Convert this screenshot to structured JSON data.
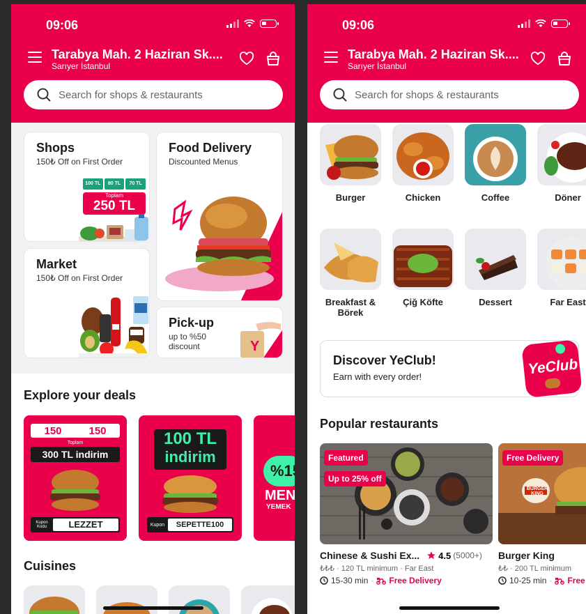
{
  "status": {
    "time": "09:06"
  },
  "header": {
    "address_title": "Tarabya Mah. 2 Haziran Sk....",
    "address_sub": "Sarıyer İstanbul",
    "icons": [
      "menu-icon",
      "heart-icon",
      "bag-icon"
    ]
  },
  "search": {
    "placeholder": "Search for shops & restaurants"
  },
  "services": {
    "shops": {
      "title": "Shops",
      "subtitle": "150₺ Off on First Order",
      "promo": {
        "tier1": "100 TL",
        "tier2": "80 TL",
        "tier3": "70 TL",
        "total_label": "Toplam",
        "total": "250 TL"
      }
    },
    "market": {
      "title": "Market",
      "subtitle": "150₺ Off on First Order"
    },
    "food": {
      "title": "Food Delivery",
      "subtitle": "Discounted Menus"
    },
    "pickup": {
      "title": "Pick-up",
      "subtitle_line1": "up to %50",
      "subtitle_line2": "discount"
    }
  },
  "deals": {
    "title": "Explore your deals",
    "items": [
      {
        "top_a": "150",
        "top_b": "150",
        "tl": "TL",
        "total_label": "Toplam",
        "headline": "300 TL indirim",
        "coupon_label": "Kupon Kodu",
        "code": "LEZZET"
      },
      {
        "headline_1": "100 TL",
        "headline_2": "indirim",
        "coupon_label": "Kupon",
        "code": "SEPETTE100"
      },
      {
        "headline_1": "%15",
        "headline_2": "MEN",
        "headline_3": "YEMEK"
      }
    ]
  },
  "cuisines_title": "Cuisines",
  "cuisines": [
    {
      "label": "Burger"
    },
    {
      "label": "Chicken"
    },
    {
      "label": "Coffee"
    },
    {
      "label": "Döner"
    },
    {
      "label": "Breakfast &\nBörek"
    },
    {
      "label": "Çiğ Köfte"
    },
    {
      "label": "Dessert"
    },
    {
      "label": "Far East"
    }
  ],
  "yeclub": {
    "title": "Discover YeClub!",
    "subtitle": "Earn with every order!",
    "logo": "YeClub"
  },
  "popular": {
    "title": "Popular restaurants",
    "items": [
      {
        "badge1": "Featured",
        "badge2": "Up to 25% off",
        "name": "Chinese & Sushi Ex...",
        "rating": "4.5",
        "reviews": "(5000+)",
        "meta": "₺₺₺ · 120 TL minimum · Far East",
        "time": "15-30 min",
        "delivery": "Free Delivery"
      },
      {
        "badge1": "Free Delivery",
        "name": "Burger King",
        "logo": "BURGER KING",
        "meta": "₺₺ · 200 TL minimum",
        "time": "10-25 min",
        "delivery": "Free"
      }
    ]
  },
  "colors": {
    "brand": "#ea004b",
    "background": "#2b2b2b",
    "surface": "#f2f2f5"
  }
}
